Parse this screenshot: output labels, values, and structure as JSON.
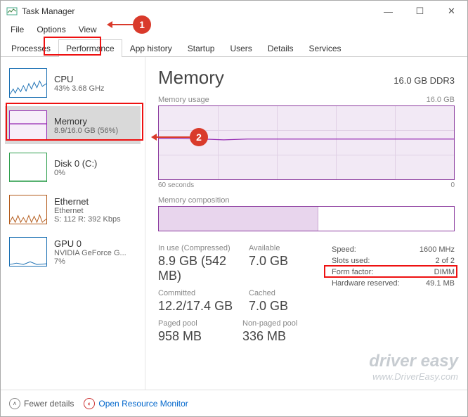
{
  "window": {
    "title": "Task Manager"
  },
  "menu": {
    "file": "File",
    "options": "Options",
    "view": "View"
  },
  "tabs": [
    "Processes",
    "Performance",
    "App history",
    "Startup",
    "Users",
    "Details",
    "Services"
  ],
  "sidebar": {
    "cpu": {
      "title": "CPU",
      "sub": "43% 3.68 GHz",
      "color": "#1a6fb3"
    },
    "memory": {
      "title": "Memory",
      "sub": "8.9/16.0 GB (56%)",
      "color": "#952ab3"
    },
    "disk": {
      "title": "Disk 0 (C:)",
      "sub": "0%",
      "color": "#2e9e4d"
    },
    "ethernet": {
      "title": "Ethernet",
      "sub2": "Ethernet",
      "sub": "S: 112 R: 392 Kbps",
      "color": "#b35a1a"
    },
    "gpu": {
      "title": "GPU 0",
      "sub2": "NVIDIA GeForce G...",
      "sub": "7%",
      "color": "#1a6fb3"
    }
  },
  "main": {
    "title": "Memory",
    "spec": "16.0 GB DDR3",
    "usage_label": "Memory usage",
    "usage_max": "16.0 GB",
    "xaxis_left": "60 seconds",
    "xaxis_right": "0",
    "composition_label": "Memory composition"
  },
  "stats": {
    "inuse_label": "In use (Compressed)",
    "inuse_value": "8.9 GB (542 MB)",
    "available_label": "Available",
    "available_value": "7.0 GB",
    "committed_label": "Committed",
    "committed_value": "12.2/17.4 GB",
    "cached_label": "Cached",
    "cached_value": "7.0 GB",
    "paged_label": "Paged pool",
    "paged_value": "958 MB",
    "nonpaged_label": "Non-paged pool",
    "nonpaged_value": "336 MB"
  },
  "details": {
    "speed_label": "Speed:",
    "speed_value": "1600 MHz",
    "slots_label": "Slots used:",
    "slots_value": "2 of 2",
    "form_label": "Form factor:",
    "form_value": "DIMM",
    "hw_label": "Hardware reserved:",
    "hw_value": "49.1 MB"
  },
  "footer": {
    "fewer": "Fewer details",
    "resmon": "Open Resource Monitor"
  },
  "annotations": {
    "badge1": "1",
    "badge2": "2"
  },
  "watermark": {
    "brand": "driver easy",
    "url": "www.DriverEasy.com"
  },
  "chart_data": {
    "type": "line",
    "title": "Memory usage",
    "ylabel": "GB",
    "ylim": [
      0,
      16.0
    ],
    "xlabel": "seconds ago",
    "xlim": [
      60,
      0
    ],
    "series": [
      {
        "name": "Memory usage (GB)",
        "values": [
          9.0,
          9.0,
          8.9,
          8.8,
          8.9,
          8.9,
          8.9,
          8.9,
          8.9,
          8.9,
          8.9,
          8.9,
          8.9
        ]
      }
    ],
    "x": [
      60,
      55,
      50,
      45,
      40,
      35,
      30,
      25,
      20,
      15,
      10,
      5,
      0
    ],
    "composition_fraction_inuse": 0.56
  }
}
